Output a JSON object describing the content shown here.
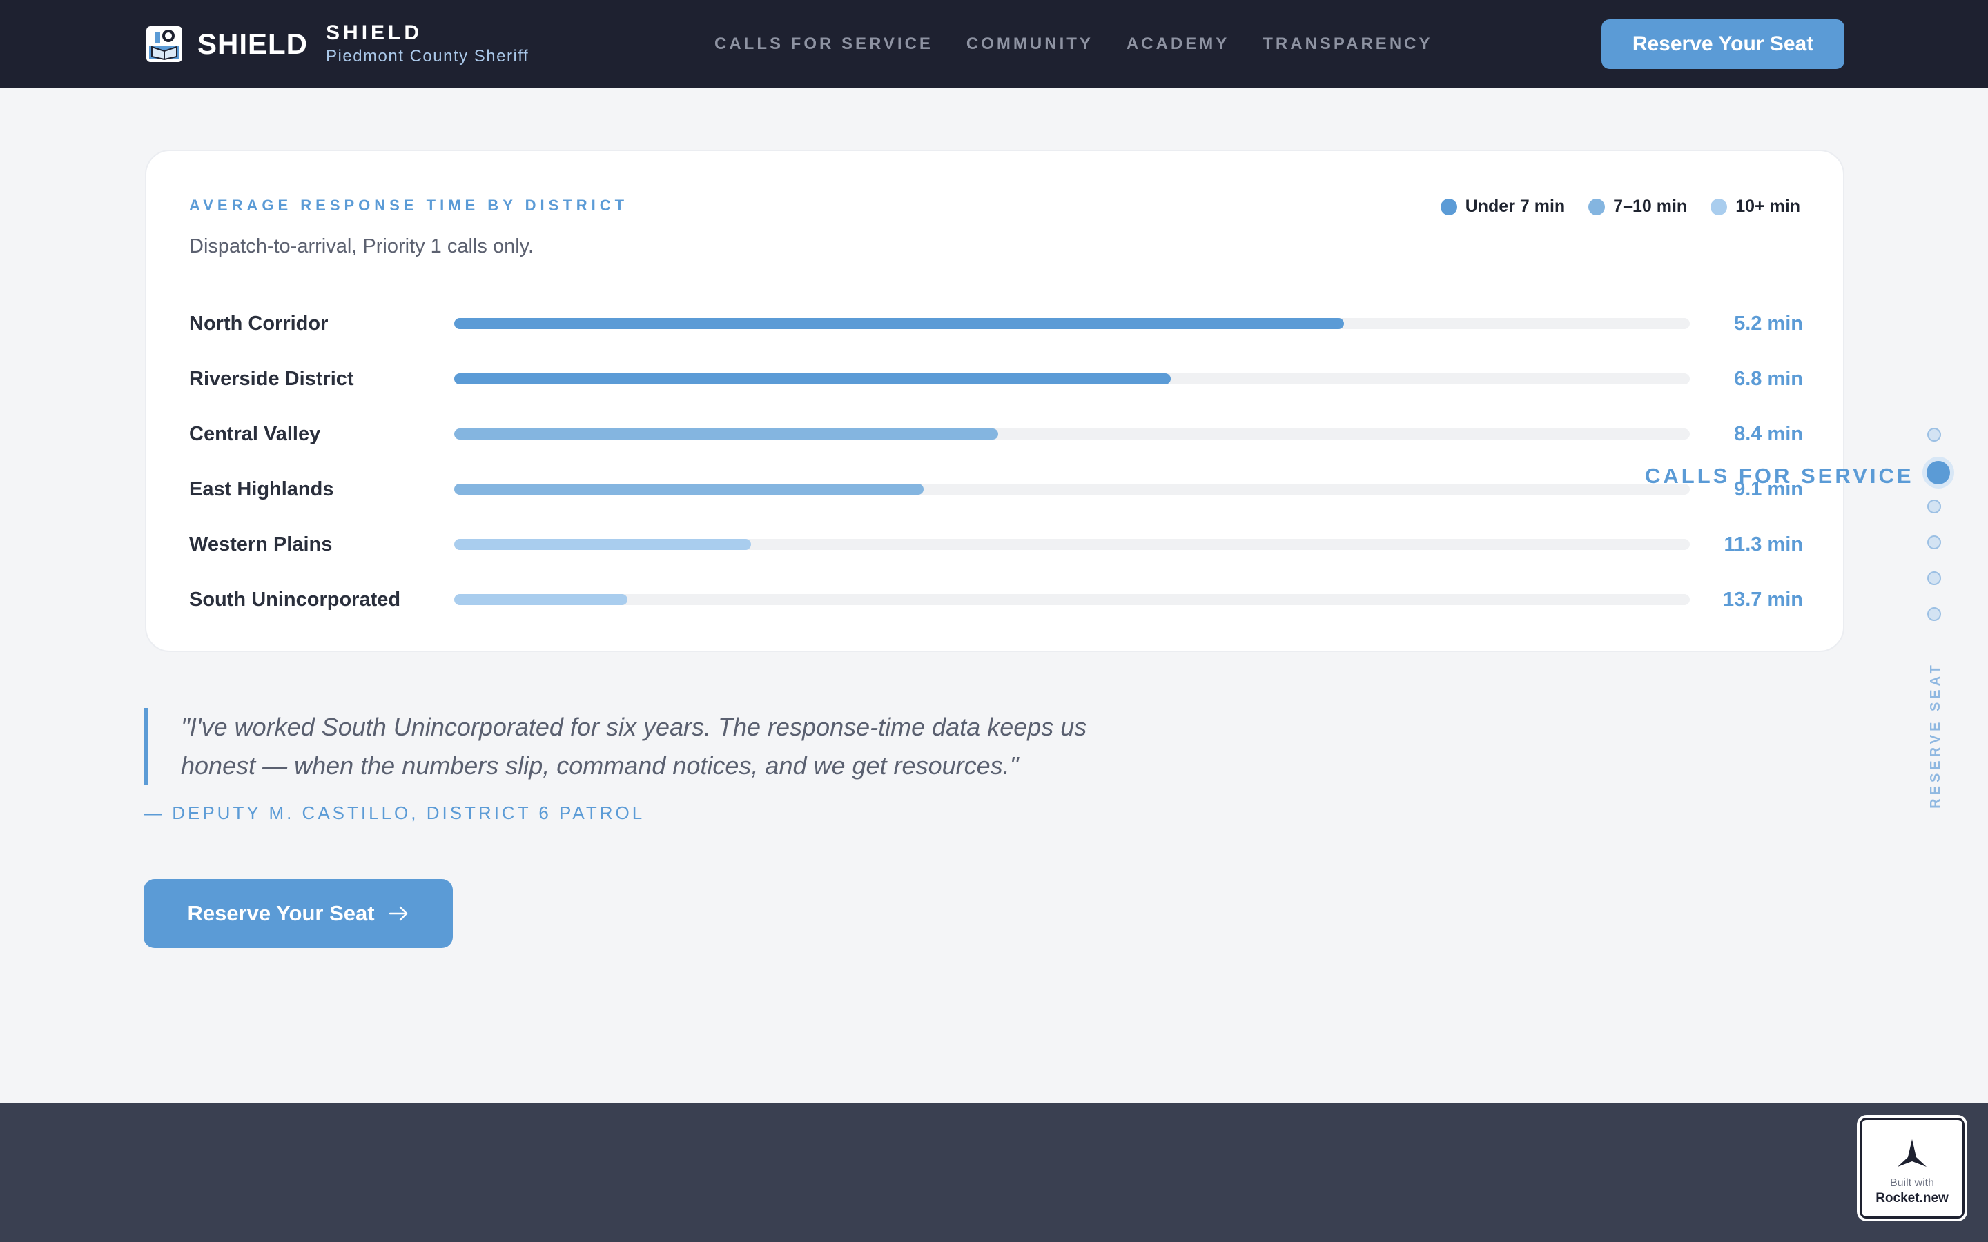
{
  "header": {
    "brand_word": "SHIELD",
    "brand_name": "SHIELD",
    "brand_sub": "Piedmont County Sheriff",
    "nav": [
      "CALLS FOR SERVICE",
      "COMMUNITY",
      "ACADEMY",
      "TRANSPARENCY"
    ],
    "cta_label": "Reserve Your Seat"
  },
  "card": {
    "title": "AVERAGE RESPONSE TIME BY DISTRICT",
    "subtitle": "Dispatch-to-arrival, Priority 1 calls only.",
    "legend": [
      {
        "label": "Under 7 min",
        "color": "#5b9bd6"
      },
      {
        "label": "7–10 min",
        "color": "#84b5e0"
      },
      {
        "label": "10+ min",
        "color": "#a9cdee"
      }
    ]
  },
  "chart_data": {
    "type": "bar",
    "orientation": "horizontal",
    "title": "AVERAGE RESPONSE TIME BY DISTRICT",
    "subtitle": "Dispatch-to-arrival, Priority 1 calls only.",
    "categories": [
      "North Corridor",
      "Riverside District",
      "Central Valley",
      "East Highlands",
      "Western Plains",
      "South Unincorporated"
    ],
    "value_labels": [
      "5.2 min",
      "6.8 min",
      "8.4 min",
      "9.1 min",
      "11.3 min",
      "13.7 min"
    ],
    "values": [
      5.2,
      6.8,
      8.4,
      9.1,
      11.3,
      13.7
    ],
    "bar_fill_fraction": [
      0.72,
      0.58,
      0.44,
      0.38,
      0.24,
      0.14
    ],
    "bar_colors": [
      "#5b9bd6",
      "#5b9bd6",
      "#84b5e0",
      "#84b5e0",
      "#a9cdee",
      "#a9cdee"
    ],
    "legend_position": "top-right",
    "grid": false
  },
  "quote": {
    "text": "\"I've worked South Unincorporated for six years. The response-time data keeps us honest — when the numbers slip, command notices, and we get resources.\"",
    "attribution": "— DEPUTY M. CASTILLO, DISTRICT 6 PATROL"
  },
  "cta_main": {
    "label": "Reserve Your Seat",
    "icon": "arrow-right-icon"
  },
  "side_nav": {
    "active_label": "CALLS FOR SERVICE",
    "dot_count": 6,
    "active_index": 1,
    "vertical_label": "RESERVE SEAT"
  },
  "badge": {
    "small": "Built with",
    "name": "Rocket.new"
  },
  "colors": {
    "accent": "#5b9bd6",
    "header_bg": "#1e2130",
    "footer_bg": "#3a4051",
    "page_bg": "#f4f5f7"
  }
}
